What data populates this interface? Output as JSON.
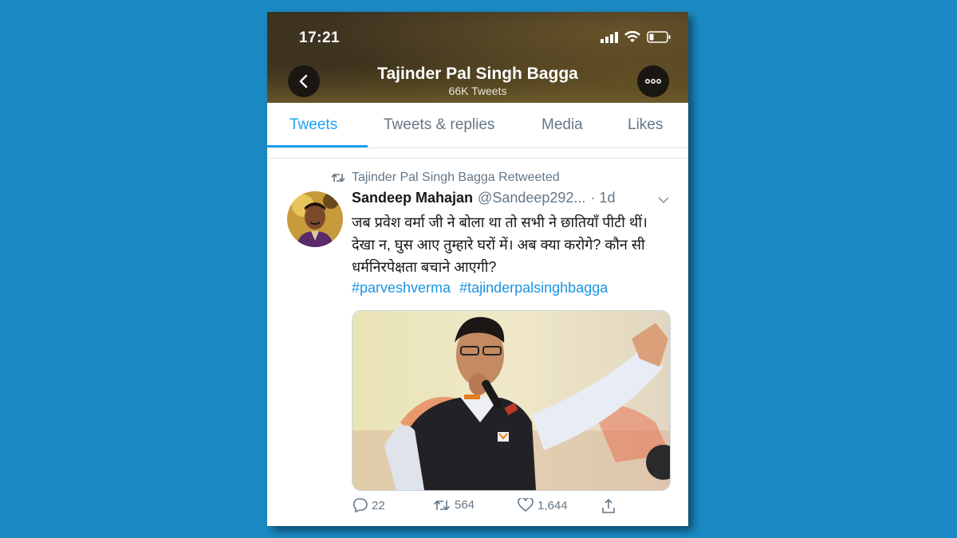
{
  "status_bar": {
    "time": "17:21"
  },
  "profile": {
    "name": "Tajinder Pal Singh Bagga",
    "tweet_count": "66K Tweets"
  },
  "tabs": [
    {
      "label": "Tweets",
      "active": true
    },
    {
      "label": "Tweets & replies",
      "active": false
    },
    {
      "label": "Media",
      "active": false
    },
    {
      "label": "Likes",
      "active": false
    }
  ],
  "tweet": {
    "retweet_label": "Tajinder Pal Singh Bagga Retweeted",
    "author_name": "Sandeep Mahajan",
    "author_handle": "@Sandeep292...",
    "time": "· 1d",
    "text": "जब प्रवेश वर्मा जी ने बोला था तो सभी ने छातियाँ पीटी थीं। देखा न, घुस आए तुम्हारे घरों में। अब क्या करोगे? कौन सी धर्मनिरपेक्षता बचाने आएगी?",
    "hashtags": [
      "#parveshverma",
      "#tajinderpalsinghbagga"
    ],
    "replies": "22",
    "retweets": "564",
    "likes": "1,644"
  },
  "colors": {
    "background": "#1b8ac4",
    "accent": "#1da1f2",
    "muted": "#657786"
  }
}
